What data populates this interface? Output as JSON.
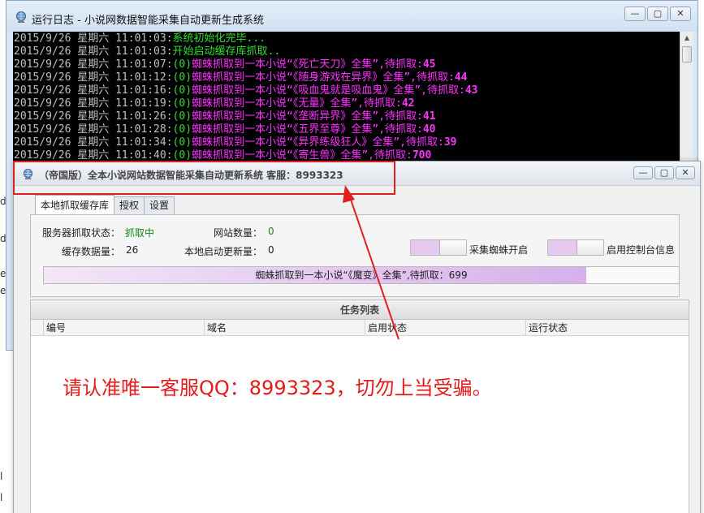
{
  "edge_fragments": [
    "dl",
    "d",
    "e.",
    "e",
    "l",
    "l"
  ],
  "console": {
    "title": "运行日志 - 小说网数据智能采集自动更新生成系统",
    "window_buttons": [
      "—",
      "▢",
      "✕"
    ],
    "lines": [
      {
        "ts": "2015/9/26 星期六 11:01:03:",
        "status": "",
        "msg": "系统初始化完毕...",
        "count": ""
      },
      {
        "ts": "2015/9/26 星期六 11:01:03:",
        "status": "",
        "msg": "开始启动缓存库抓取..",
        "count": ""
      },
      {
        "ts": "2015/9/26 星期六 11:01:07:",
        "status": "(0)",
        "msg": "蜘蛛抓取到一本小说“《死亡天刀》全集”,待抓取:",
        "count": "45"
      },
      {
        "ts": "2015/9/26 星期六 11:01:12:",
        "status": "(0)",
        "msg": "蜘蛛抓取到一本小说“《随身游戏在异界》全集”,待抓取:",
        "count": "44"
      },
      {
        "ts": "2015/9/26 星期六 11:01:16:",
        "status": "(0)",
        "msg": "蜘蛛抓取到一本小说“《吸血鬼就是吸血鬼》全集”,待抓取:",
        "count": "43"
      },
      {
        "ts": "2015/9/26 星期六 11:01:19:",
        "status": "(0)",
        "msg": "蜘蛛抓取到一本小说“《无量》全集”,待抓取:",
        "count": "42"
      },
      {
        "ts": "2015/9/26 星期六 11:01:26:",
        "status": "(0)",
        "msg": "蜘蛛抓取到一本小说“《垄断异界》全集”,待抓取:",
        "count": "41"
      },
      {
        "ts": "2015/9/26 星期六 11:01:28:",
        "status": "(0)",
        "msg": "蜘蛛抓取到一本小说“《五界至尊》全集”,待抓取:",
        "count": "40"
      },
      {
        "ts": "2015/9/26 星期六 11:01:34:",
        "status": "(0)",
        "msg": "蜘蛛抓取到一本小说“《异界练级狂人》全集”,待抓取:",
        "count": "39"
      },
      {
        "ts": "2015/9/26 星期六 11:01:40:",
        "status": "(0)",
        "msg": "蜘蛛抓取到一本小说“《寄生兽》全集”,待抓取:",
        "count": "700"
      }
    ]
  },
  "main": {
    "title": "（帝国版）全本小说网站数据智能采集自动更新系统 客服：8993323",
    "window_buttons": [
      "—",
      "▢",
      "✕"
    ],
    "tabs": [
      "本地抓取缓存库",
      "授权",
      "设置"
    ],
    "status": {
      "server_label": "服务器抓取状态：",
      "server_value": "抓取中",
      "site_label": "网站数量：",
      "site_value": "0",
      "cache_label": "缓存数据量：",
      "cache_value": "26",
      "update_label": "本地启动更新量：",
      "update_value": "0"
    },
    "toggle_spider": "采集蜘蛛开启",
    "toggle_console": "启用控制台信息",
    "progress_text": "蜘蛛抓取到一本小说“《魔变》全集”,待抓取：699",
    "task_list": {
      "title": "任务列表",
      "columns": [
        "编号",
        "域名",
        "启用状态",
        "运行状态"
      ]
    }
  },
  "warning": "请认准唯一客服QQ：8993323，切勿上当受骗。",
  "colors": {
    "annotation_red": "#e02020",
    "console_green": "#33dd33",
    "console_magenta": "#ff33ff"
  }
}
